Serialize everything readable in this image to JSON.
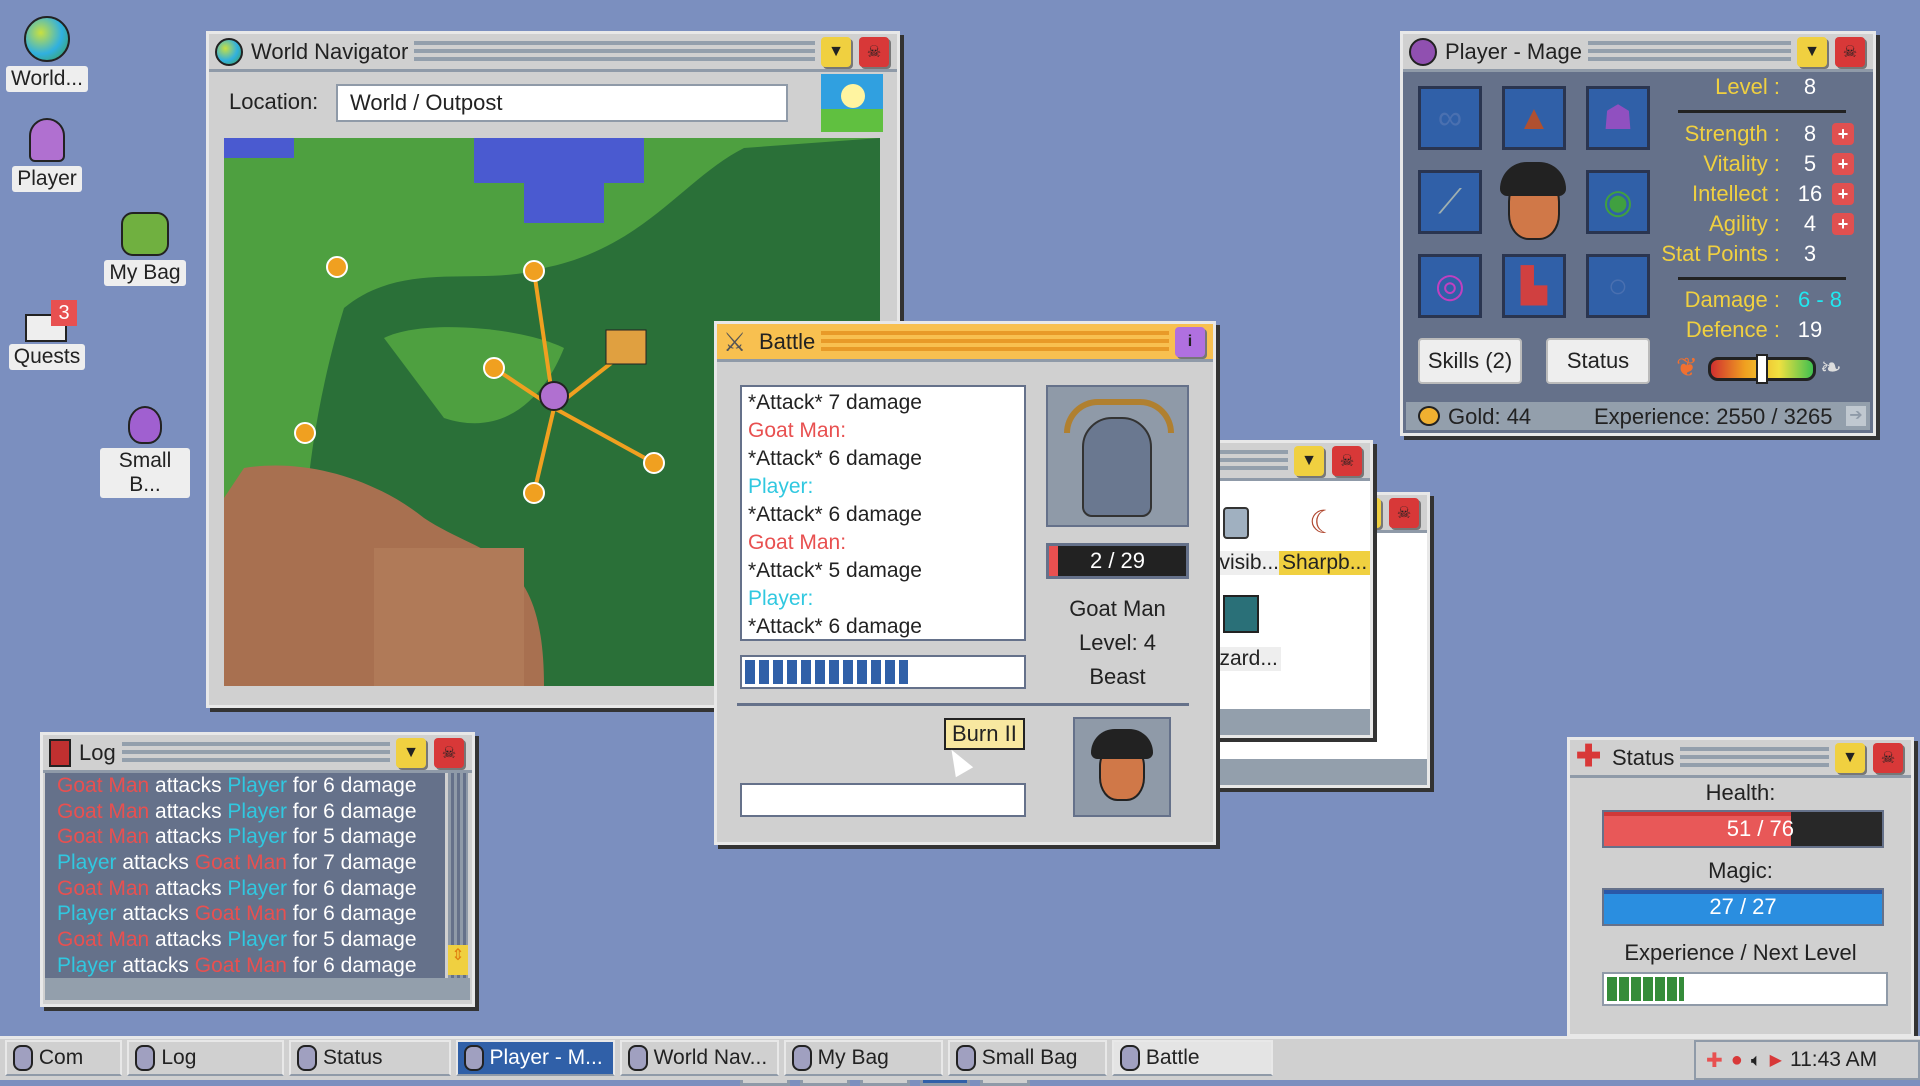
{
  "desktop": {
    "icons": [
      {
        "label": "World...",
        "icon": "globe-icon"
      },
      {
        "label": "Player",
        "icon": "hooded-mage-icon"
      },
      {
        "label": "My Bag",
        "icon": "backpack-icon"
      },
      {
        "label": "Quests",
        "icon": "envelope-icon",
        "badge": "3"
      },
      {
        "label": "Small B...",
        "icon": "pouch-icon"
      }
    ]
  },
  "world": {
    "title": "World Navigator",
    "location_label": "Location:",
    "location_value": "World / Outpost"
  },
  "player": {
    "title": "Player - Mage",
    "level_label": "Level :",
    "level": "8",
    "stats": [
      {
        "label": "Strength :",
        "value": "8"
      },
      {
        "label": "Vitality :",
        "value": "5"
      },
      {
        "label": "Intellect :",
        "value": "16"
      },
      {
        "label": "Agility :",
        "value": "4"
      }
    ],
    "stat_points_label": "Stat Points :",
    "stat_points": "3",
    "damage_label": "Damage :",
    "damage": "6 - 8",
    "defence_label": "Defence :",
    "defence": "19",
    "skills_button": "Skills (2)",
    "status_button": "Status",
    "alignment": 0.5,
    "gold": "Gold: 44",
    "experience": "Experience: 2550 / 3265"
  },
  "battle": {
    "title": "Battle",
    "log": [
      {
        "text": "*Attack* 7 damage",
        "kind": "attack"
      },
      {
        "text": "Goat Man:",
        "kind": "enemy"
      },
      {
        "text": "*Attack* 6 damage",
        "kind": "attack"
      },
      {
        "text": "Player:",
        "kind": "player"
      },
      {
        "text": "*Attack* 6 damage",
        "kind": "attack"
      },
      {
        "text": "Goat Man:",
        "kind": "enemy"
      },
      {
        "text": "*Attack* 5 damage",
        "kind": "attack"
      },
      {
        "text": "Player:",
        "kind": "player"
      },
      {
        "text": "*Attack* 6 damage",
        "kind": "attack"
      }
    ],
    "turn_progress": 0.59,
    "enemy_hp": "2 / 29",
    "enemy_hp_fraction": 0.069,
    "enemy_name": "Goat Man",
    "enemy_level": "Level: 4",
    "enemy_type": "Beast",
    "skills": [
      "attack-icon",
      "shield-icon",
      "burst-icon",
      "burn-icon",
      "dash-icon"
    ],
    "tooltip": "Burn II"
  },
  "bag": {
    "items": [
      "...visib...",
      "Sharpb...",
      "...zard..."
    ]
  },
  "log": {
    "title": "Log",
    "lines": [
      [
        [
          "Goat Man",
          "red"
        ],
        [
          " attacks ",
          ""
        ],
        [
          "Player",
          "cyan"
        ],
        [
          " for 6 damage",
          ""
        ]
      ],
      [
        [
          "Goat Man",
          "red"
        ],
        [
          " attacks ",
          ""
        ],
        [
          "Player",
          "cyan"
        ],
        [
          " for 6 damage",
          ""
        ]
      ],
      [
        [
          "Goat Man",
          "red"
        ],
        [
          " attacks ",
          ""
        ],
        [
          "Player",
          "cyan"
        ],
        [
          " for 5 damage",
          ""
        ]
      ],
      [
        [
          "Player",
          "cyan"
        ],
        [
          " attacks ",
          ""
        ],
        [
          "Goat Man",
          "red"
        ],
        [
          " for 7 damage",
          ""
        ]
      ],
      [
        [
          "Goat Man",
          "red"
        ],
        [
          " attacks ",
          ""
        ],
        [
          "Player",
          "cyan"
        ],
        [
          " for 6 damage",
          ""
        ]
      ],
      [
        [
          "Player",
          "cyan"
        ],
        [
          " attacks ",
          ""
        ],
        [
          "Goat Man",
          "red"
        ],
        [
          " for 6 damage",
          ""
        ]
      ],
      [
        [
          "Goat Man",
          "red"
        ],
        [
          " attacks ",
          ""
        ],
        [
          "Player",
          "cyan"
        ],
        [
          " for 5 damage",
          ""
        ]
      ],
      [
        [
          "Player",
          "cyan"
        ],
        [
          " attacks ",
          ""
        ],
        [
          "Goat Man",
          "red"
        ],
        [
          " for 6 damage",
          ""
        ]
      ]
    ]
  },
  "status": {
    "title": "Status",
    "health_label": "Health:",
    "health": "51 / 76",
    "health_fraction": 0.671,
    "magic_label": "Magic:",
    "magic": "27 / 27",
    "magic_fraction": 1.0,
    "exp_label": "Experience / Next Level",
    "exp_fraction": 0.28
  },
  "taskbar": {
    "items": [
      {
        "label": "Com",
        "icon": "compass-icon"
      },
      {
        "label": "Log",
        "icon": "book-icon"
      },
      {
        "label": "Status",
        "icon": "cross-icon"
      },
      {
        "label": "Player - M...",
        "icon": "mage-icon"
      },
      {
        "label": "World Nav...",
        "icon": "globe-icon"
      },
      {
        "label": "My Bag",
        "icon": "backpack-icon"
      },
      {
        "label": "Small Bag",
        "icon": "pouch-icon"
      },
      {
        "label": "Battle",
        "icon": "swords-icon"
      }
    ],
    "time": "11:43 AM"
  },
  "colors": {
    "desktop": "#7b8fbf",
    "health": "#e85858",
    "magic": "#2a8ee0",
    "exp": "#358c3a",
    "battle_title": "#f8c050"
  }
}
